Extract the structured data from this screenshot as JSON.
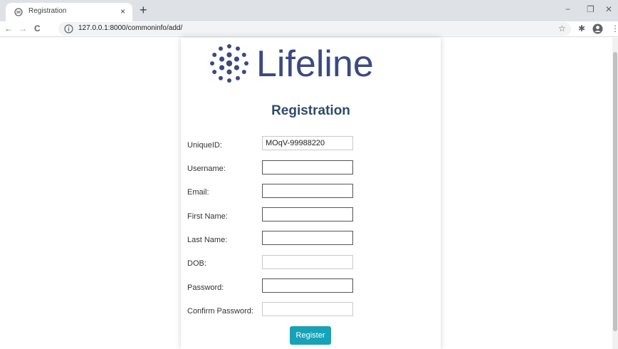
{
  "browser": {
    "tab_title": "Registration",
    "tab_close": "×",
    "new_tab": "+",
    "url": "127.0.0.1:8000/commoninfo/add/",
    "window_controls": {
      "minimize": "−",
      "restore": "❐",
      "close": "✕"
    },
    "nav": {
      "back": "←",
      "forward": "→",
      "reload": "C"
    },
    "toolbar_icons": {
      "bookmark": "☆",
      "extensions": "✱",
      "menu": "⋮"
    }
  },
  "page": {
    "logo_text": "Lifeline",
    "heading": "Registration",
    "form": {
      "fields": [
        {
          "label": "UniqueID:",
          "value": "MOqV-99988220"
        },
        {
          "label": "Username:",
          "value": ""
        },
        {
          "label": "Email:",
          "value": ""
        },
        {
          "label": "First Name:",
          "value": ""
        },
        {
          "label": "Last Name:",
          "value": ""
        },
        {
          "label": "DOB:",
          "value": ""
        },
        {
          "label": "Password:",
          "value": ""
        },
        {
          "label": "Confirm Password:",
          "value": ""
        }
      ],
      "submit_label": "Register"
    }
  },
  "colors": {
    "logo": "#3b4a82",
    "heading": "#2f4b6b",
    "button": "#17a2b8"
  }
}
